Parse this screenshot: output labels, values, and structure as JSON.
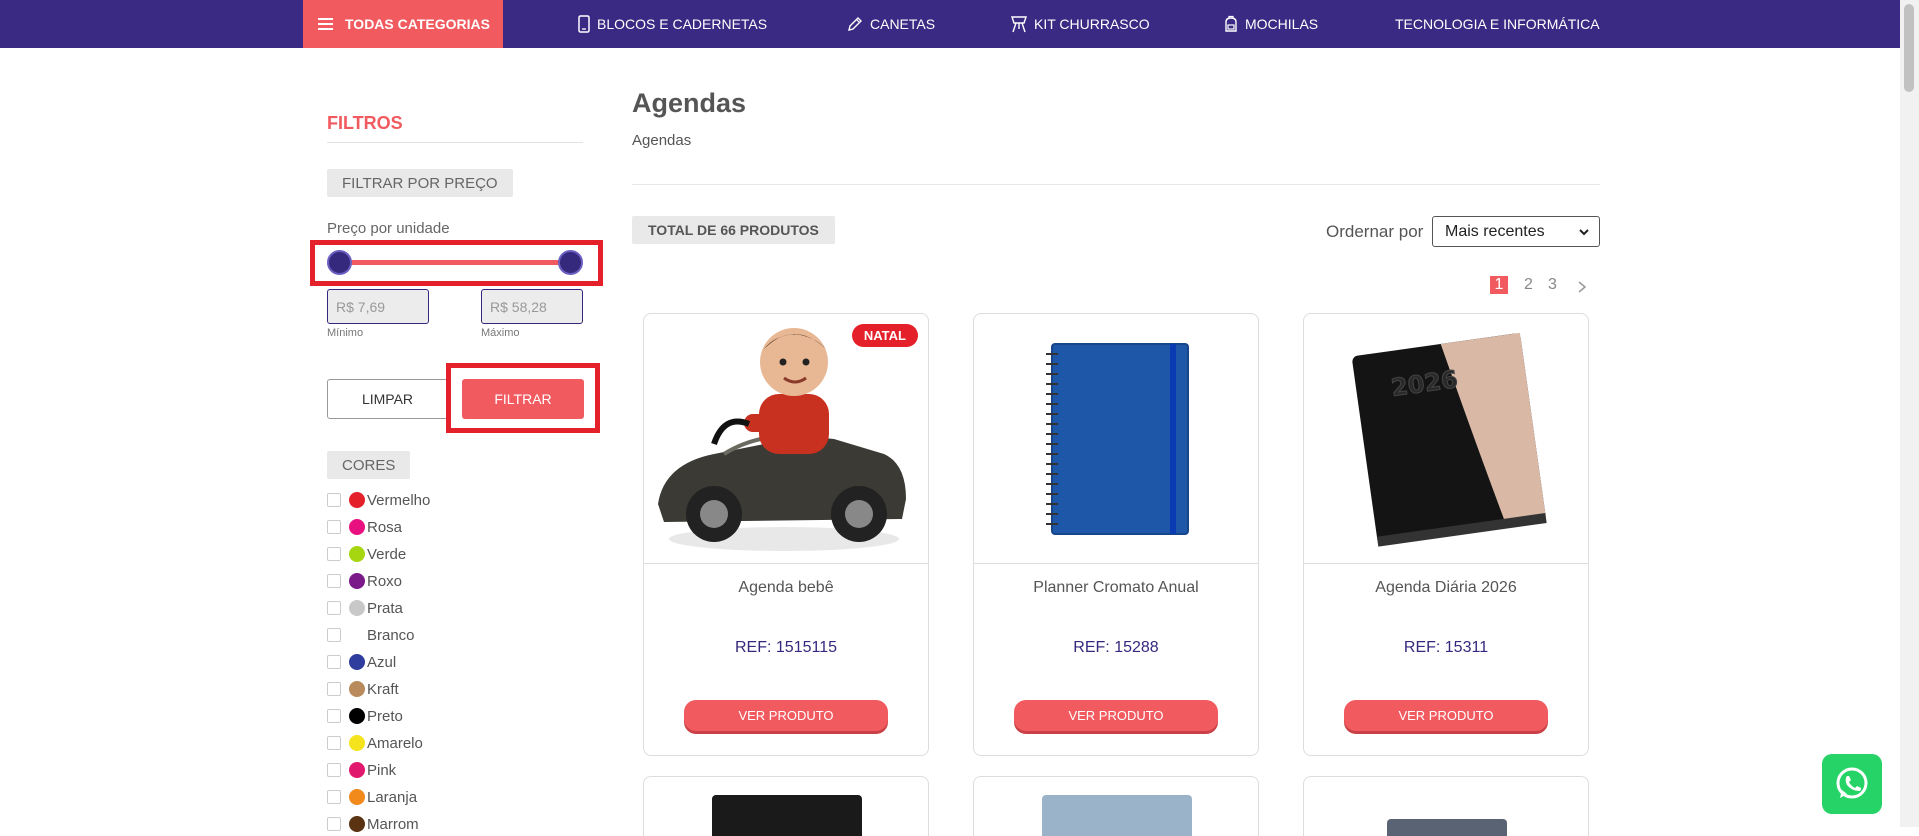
{
  "nav": {
    "all_categories": "TODAS CATEGORIAS",
    "items": [
      {
        "label": "BLOCOS E CADERNETAS",
        "icon": "tablet-icon"
      },
      {
        "label": "CANETAS",
        "icon": "pen-icon"
      },
      {
        "label": "KIT CHURRASCO",
        "icon": "grill-icon"
      },
      {
        "label": "MOCHILAS",
        "icon": "backpack-icon"
      },
      {
        "label": "TECNOLOGIA E INFORMÁTICA",
        "icon": ""
      }
    ]
  },
  "sidebar": {
    "title": "FILTROS",
    "price_filter_label": "FILTRAR POR PREÇO",
    "unit_price_label": "Preço por unidade",
    "min_placeholder": "R$ 7,69",
    "max_placeholder": "R$ 58,28",
    "min_label": "Mínimo",
    "max_label": "Máximo",
    "clear_label": "LIMPAR",
    "filter_label": "FILTRAR",
    "colors_label": "CORES",
    "colors": [
      {
        "name": "Vermelho",
        "hex": "#e4202a"
      },
      {
        "name": "Rosa",
        "hex": "#e8117f"
      },
      {
        "name": "Verde",
        "hex": "#a6d60f"
      },
      {
        "name": "Roxo",
        "hex": "#7b1b8a"
      },
      {
        "name": "Prata",
        "hex": "#c8c8c8"
      },
      {
        "name": "Branco",
        "hex": "#ffffff"
      },
      {
        "name": "Azul",
        "hex": "#2f3e9e"
      },
      {
        "name": "Kraft",
        "hex": "#b98a5b"
      },
      {
        "name": "Preto",
        "hex": "#000000"
      },
      {
        "name": "Amarelo",
        "hex": "#f4e31d"
      },
      {
        "name": "Pink",
        "hex": "#e0196f"
      },
      {
        "name": "Laranja",
        "hex": "#f28a1b"
      },
      {
        "name": "Marrom",
        "hex": "#5a3412"
      }
    ]
  },
  "main": {
    "title": "Agendas",
    "breadcrumb": "Agendas",
    "total": "TOTAL DE 66 PRODUTOS",
    "order_label": "Ordernar por",
    "order_value": "Mais recentes",
    "pages": [
      "1",
      "2",
      "3"
    ],
    "products": [
      {
        "name": "Agenda bebê",
        "ref": "REF: 1515115",
        "badge": "NATAL",
        "button": "VER PRODUTO"
      },
      {
        "name": "Planner Cromato Anual",
        "ref": "REF: 15288",
        "badge": "",
        "button": "VER PRODUTO"
      },
      {
        "name": "Agenda Diária 2026",
        "ref": "REF: 15311",
        "badge": "",
        "button": "VER PRODUTO"
      }
    ]
  },
  "colors": {
    "brand_purple": "#3a2a83",
    "accent_red": "#f15a5f",
    "highlight": "#e4202a"
  }
}
